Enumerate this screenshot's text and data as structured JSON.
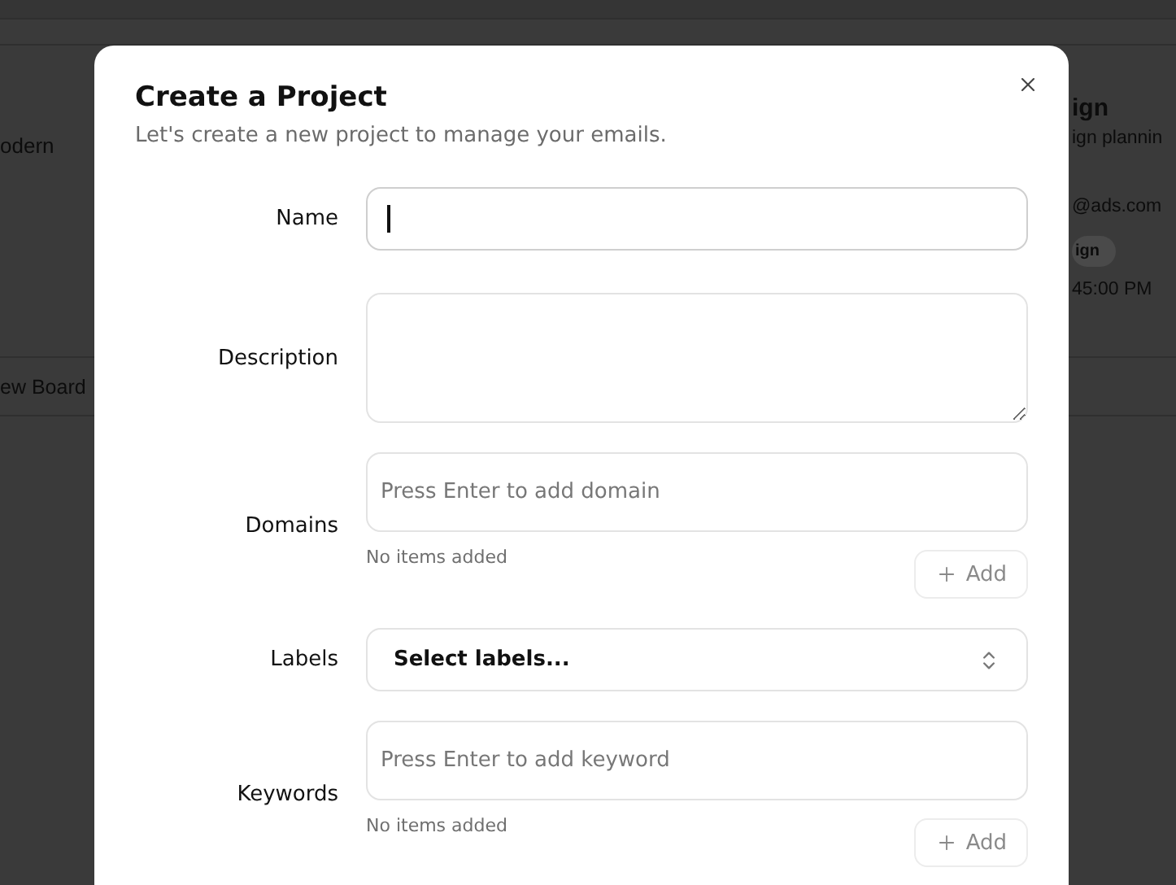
{
  "background": {
    "left_card_text": "odern",
    "left_footer": "ew Board",
    "right_card": {
      "title": "ign",
      "subtitle": "ign plannin",
      "email": "@ads.com",
      "tag": "ign",
      "time": "45:00 PM"
    }
  },
  "dialog": {
    "title": "Create a Project",
    "subtitle": "Let's create a new project to manage your emails.",
    "fields": [
      {
        "kind": "text",
        "label": "Name",
        "focused": true
      },
      {
        "kind": "textarea",
        "label": "Description"
      },
      {
        "kind": "tags",
        "label": "Domains",
        "placeholder": "Press Enter to add domain",
        "empty_note": "No items added",
        "button": {
          "label": "Add",
          "disabled": true
        }
      },
      {
        "kind": "select",
        "label": "Labels",
        "value": "Select labels..."
      },
      {
        "kind": "tags",
        "label": "Keywords",
        "placeholder": "Press Enter to add keyword",
        "empty_note": "No items added",
        "button": {
          "label": "Add",
          "disabled": true
        }
      }
    ]
  }
}
